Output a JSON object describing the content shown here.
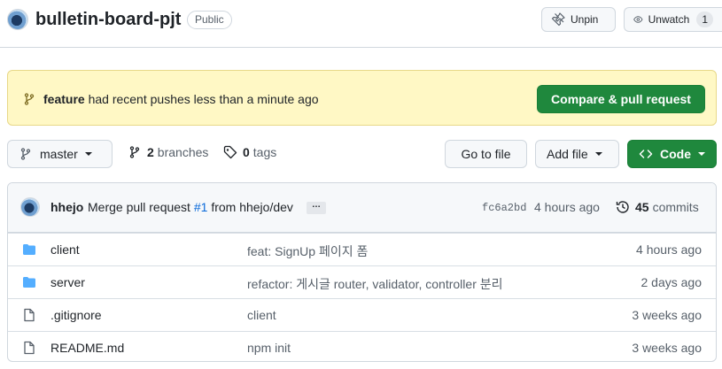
{
  "header": {
    "repo_name": "bulletin-board-pjt",
    "visibility": "Public",
    "unpin_label": "Unpin",
    "watch_label": "Unwatch",
    "watch_count": "1"
  },
  "banner": {
    "branch": "feature",
    "message": "had recent pushes less than a minute ago",
    "compare_label": "Compare & pull request"
  },
  "toolbar": {
    "branch_label": "master",
    "branches_count": "2",
    "branches_label": "branches",
    "tags_count": "0",
    "tags_label": "tags",
    "goto_label": "Go to file",
    "addfile_label": "Add file",
    "code_label": "Code"
  },
  "commit": {
    "author": "hhejo",
    "message_prefix": "Merge pull request",
    "pr_number": "#1",
    "message_suffix": "from hhejo/dev",
    "ellipsis": "…",
    "sha": "fc6a2bd",
    "time": "4 hours ago",
    "commit_count": "45",
    "commits_label": "commits"
  },
  "files": [
    {
      "type": "folder",
      "name": "client",
      "commit": "feat: SignUp 페이지 폼",
      "age": "4 hours ago"
    },
    {
      "type": "folder",
      "name": "server",
      "commit": "refactor: 게시글 router, validator, controller 분리",
      "age": "2 days ago"
    },
    {
      "type": "file",
      "name": ".gitignore",
      "commit": "client",
      "age": "3 weeks ago"
    },
    {
      "type": "file",
      "name": "README.md",
      "commit": "npm init",
      "age": "3 weeks ago"
    }
  ],
  "colors": {
    "primary_green": "#1f883d",
    "banner_bg": "#fff8c5",
    "folder_blue": "#54aeff",
    "link_blue": "#0969da"
  }
}
